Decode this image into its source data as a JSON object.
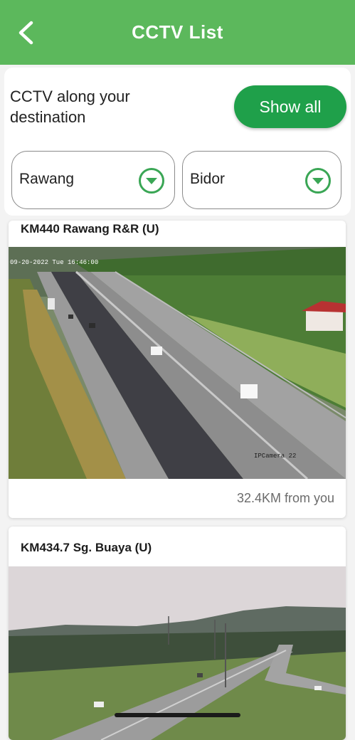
{
  "header": {
    "title": "CCTV List",
    "back_icon": "chevron-left-icon",
    "bg_color": "#5cb85c"
  },
  "filter": {
    "description": "CCTV along your destination",
    "show_all_label": "Show all",
    "origin": "Rawang",
    "destination": "Bidor",
    "accent_color": "#1fa04a"
  },
  "cameras": [
    {
      "title": "KM440 Rawang R&R (U)",
      "timestamp": "09-20-2022 Tue 16:46:00",
      "camera_label": "IPCamera 22",
      "distance": "32.4KM from you"
    },
    {
      "title": "KM434.7 Sg. Buaya (U)"
    }
  ]
}
